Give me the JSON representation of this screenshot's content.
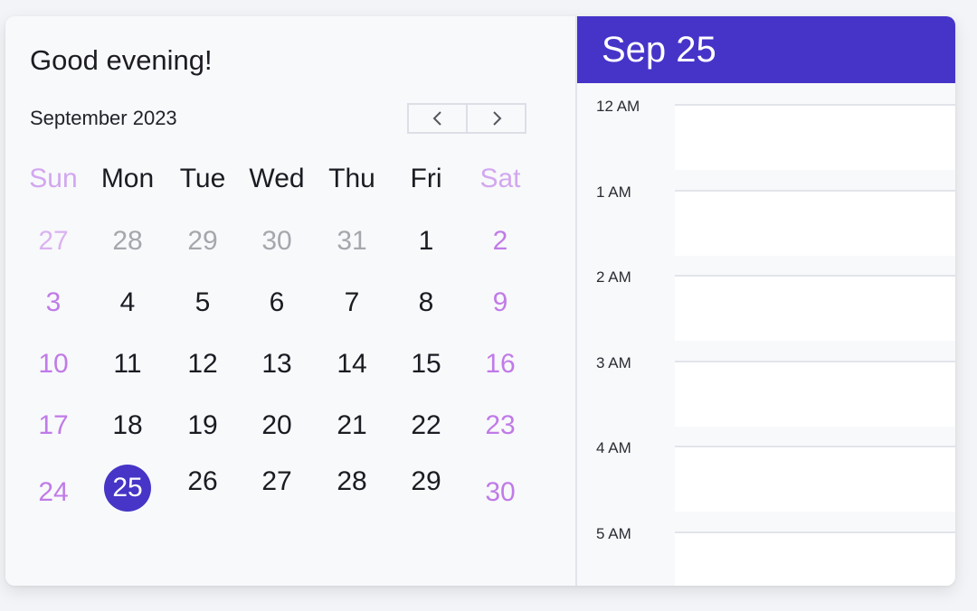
{
  "greeting": "Good evening!",
  "calendar": {
    "month_label": "September 2023",
    "nav": {
      "prev_icon": "chevron-left-icon",
      "next_icon": "chevron-right-icon"
    },
    "weekdays": [
      "Sun",
      "Mon",
      "Tue",
      "Wed",
      "Thu",
      "Fri",
      "Sat"
    ],
    "weeks": [
      [
        "27",
        "28",
        "29",
        "30",
        "31",
        "1",
        "2"
      ],
      [
        "3",
        "4",
        "5",
        "6",
        "7",
        "8",
        "9"
      ],
      [
        "10",
        "11",
        "12",
        "13",
        "14",
        "15",
        "16"
      ],
      [
        "17",
        "18",
        "19",
        "20",
        "21",
        "22",
        "23"
      ],
      [
        "24",
        "25",
        "26",
        "27",
        "28",
        "29",
        "30"
      ]
    ],
    "selected_day": "25",
    "colors": {
      "accent": "#4635c7",
      "weekend": "#c07be8",
      "outside_month": "#a6a7ad"
    }
  },
  "day_view": {
    "header": "Sep 25",
    "hours": [
      "12 AM",
      "1 AM",
      "2 AM",
      "3 AM",
      "4 AM",
      "5 AM"
    ]
  }
}
